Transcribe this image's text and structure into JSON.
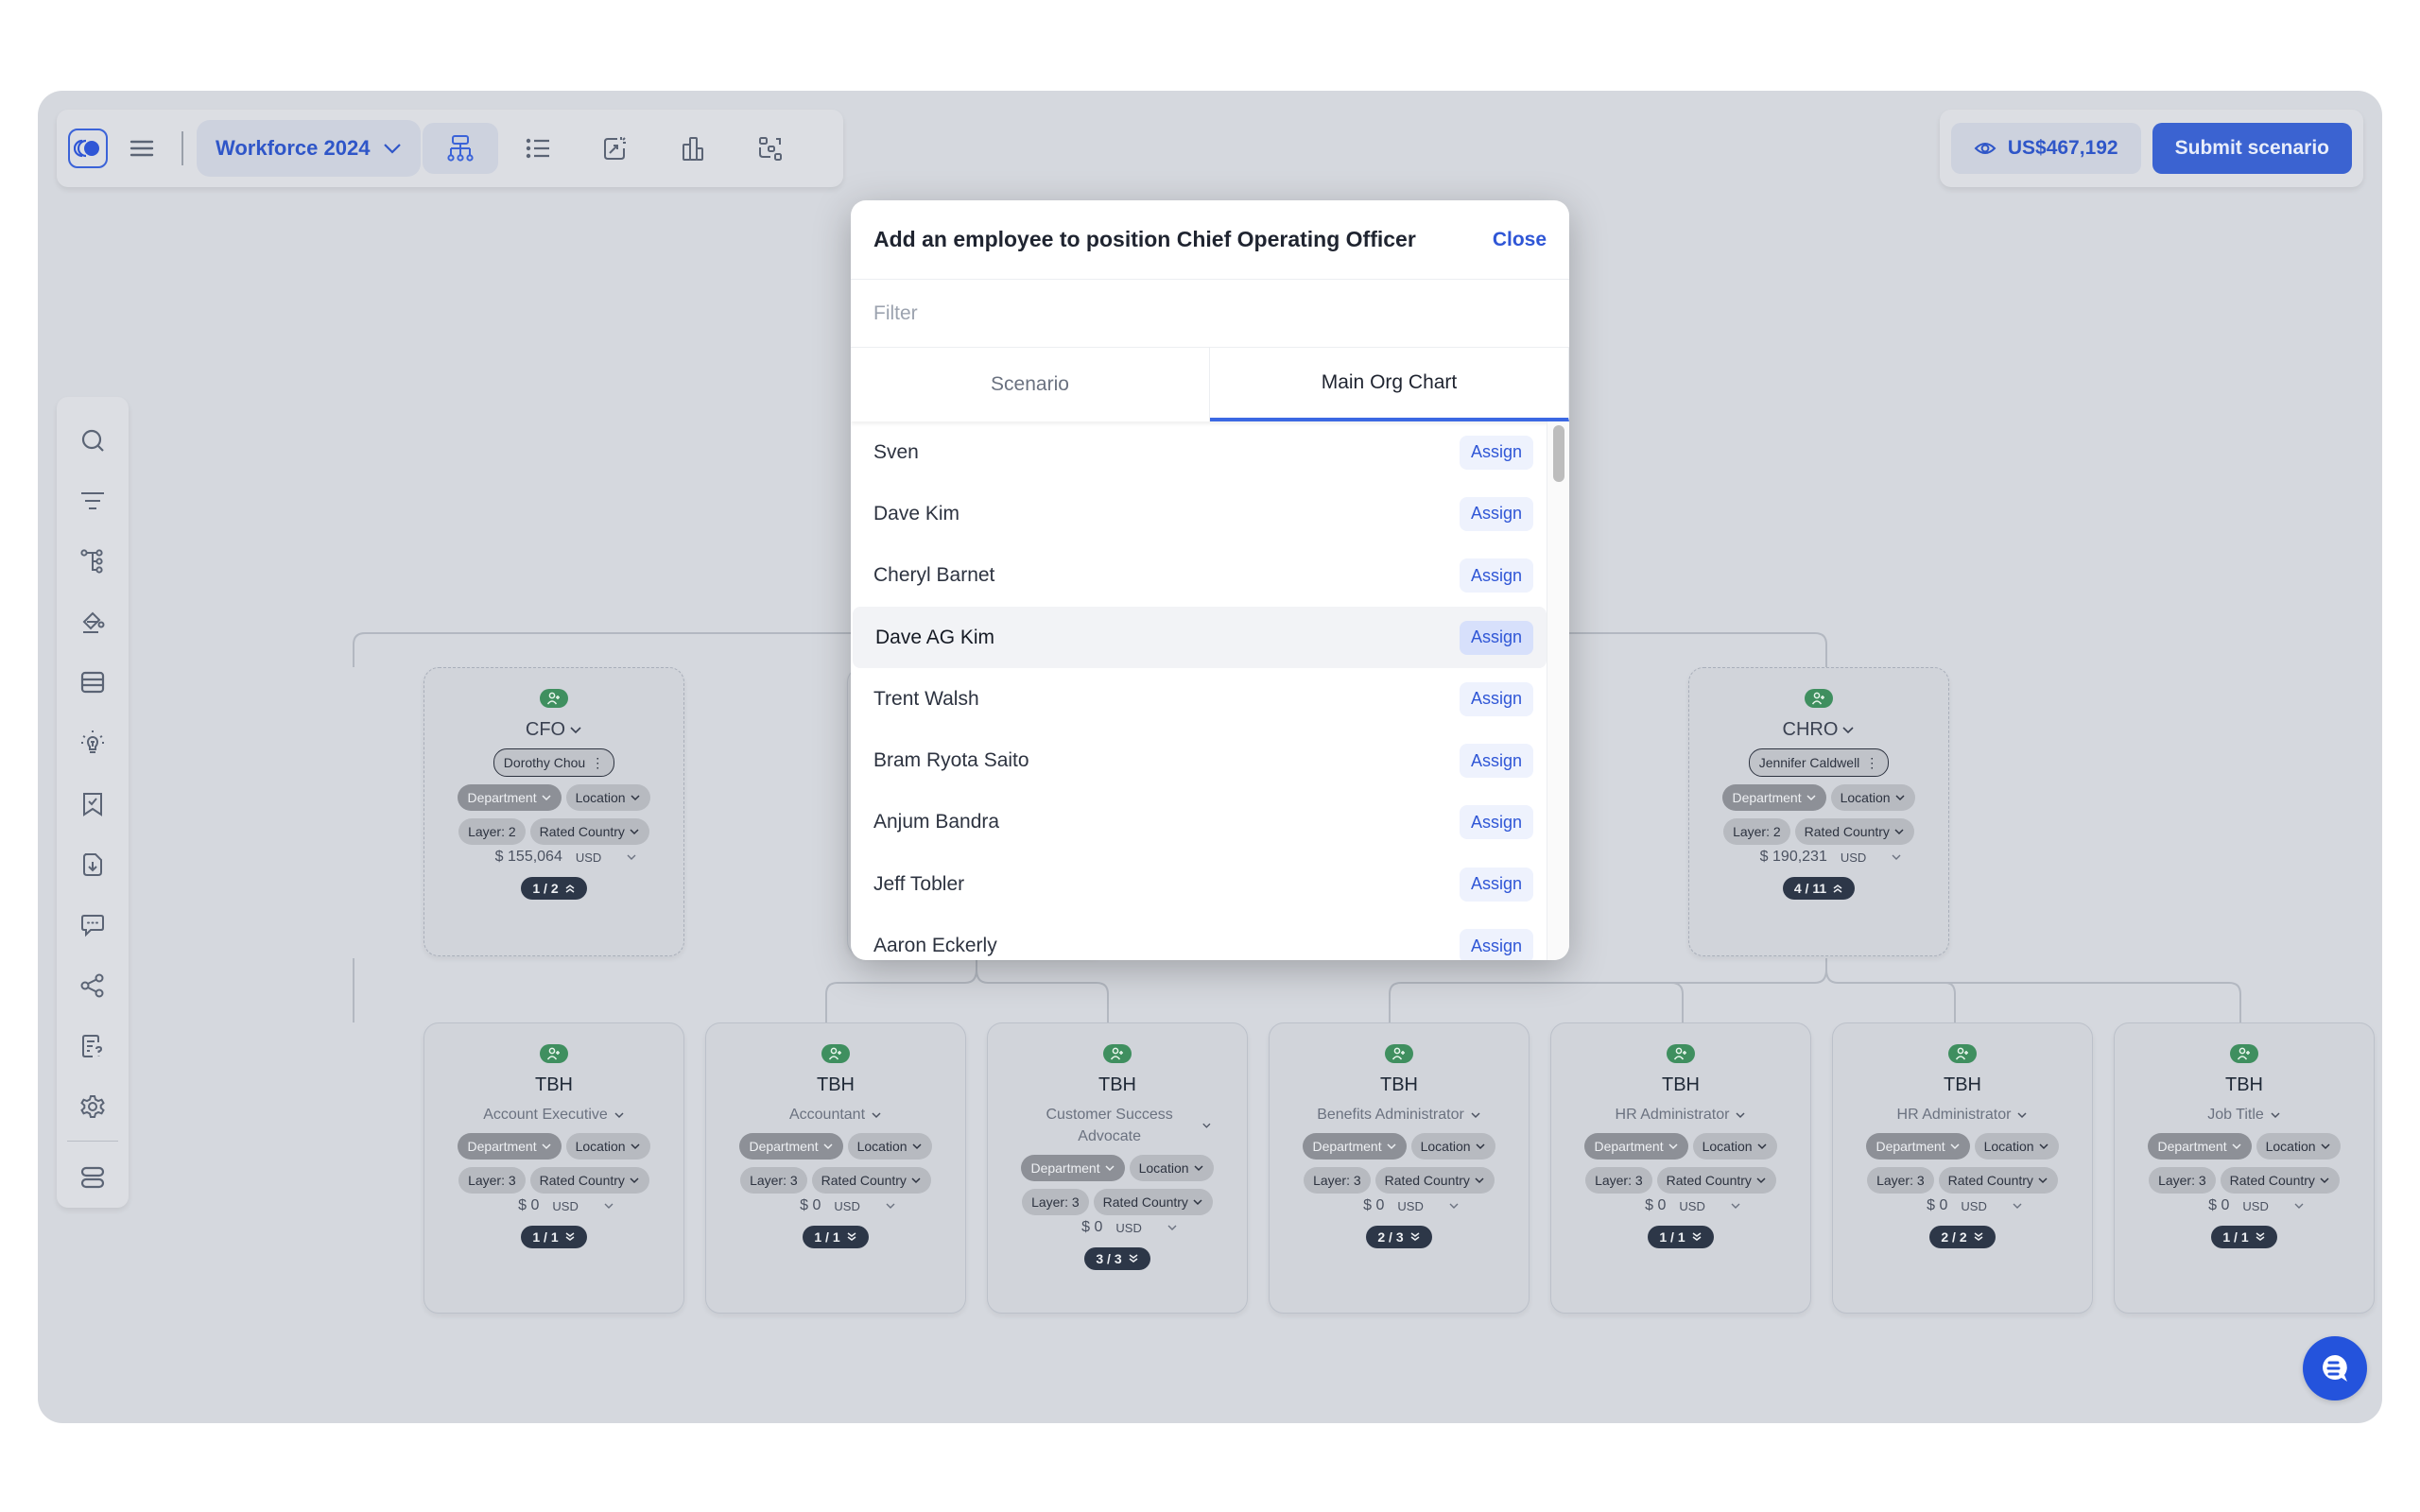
{
  "toolbar": {
    "scenario_name": "Workforce 2024",
    "view_buttons": [
      "org-chart-view",
      "list-view",
      "analytics-view",
      "bar-chart-view",
      "layout-view"
    ],
    "active_view": "org-chart-view"
  },
  "header_right": {
    "total_cost": "US$467,192",
    "submit_label": "Submit scenario"
  },
  "left_rail": {
    "items": [
      "search",
      "filter",
      "hierarchy",
      "paint-bucket",
      "table",
      "lightbulb",
      "bookmark-check",
      "file-download",
      "comment",
      "share",
      "document-question",
      "settings"
    ],
    "bottom_item": "layers"
  },
  "modal": {
    "title": "Add an employee to position Chief Operating Officer",
    "close_label": "Close",
    "filter_placeholder": "Filter",
    "filter_value": "",
    "tabs": [
      {
        "label": "Scenario",
        "active": false
      },
      {
        "label": "Main Org Chart",
        "active": true
      }
    ],
    "assign_label": "Assign",
    "employees": [
      {
        "name": "Sven"
      },
      {
        "name": "Dave Kim"
      },
      {
        "name": "Cheryl Barnet"
      },
      {
        "name": "Dave AG Kim",
        "hovered": true
      },
      {
        "name": "Trent Walsh"
      },
      {
        "name": "Bram Ryota Saito"
      },
      {
        "name": "Anjum Bandra"
      },
      {
        "name": "Jeff Tobler"
      },
      {
        "name": "Aaron Eckerly"
      }
    ]
  },
  "org_chart": {
    "chip_labels": {
      "department": "Department",
      "location": "Location",
      "rated_country": "Rated Country",
      "currency": "USD"
    },
    "layer2": [
      {
        "title": "CFO",
        "person": "Dorothy Chou",
        "layer": "Layer: 2",
        "salary": "$ 155,064",
        "count": "1 / 2",
        "expanded": true
      },
      {
        "title": "CHRO",
        "person": "Jennifer Caldwell",
        "layer": "Layer: 2",
        "salary": "$ 190,231",
        "count": "4 / 11",
        "expanded": true
      }
    ],
    "layer3": [
      {
        "name": "TBH",
        "job": "Account Executive",
        "layer": "Layer: 3",
        "salary": "$ 0",
        "count": "1 / 1"
      },
      {
        "name": "TBH",
        "job": "Accountant",
        "layer": "Layer: 3",
        "salary": "$ 0",
        "count": "1 / 1"
      },
      {
        "name": "TBH",
        "job": "Customer Success Advocate",
        "layer": "Layer: 3",
        "salary": "$ 0",
        "count": "3 / 3"
      },
      {
        "name": "TBH",
        "job": "Benefits Administrator",
        "layer": "Layer: 3",
        "salary": "$ 0",
        "count": "2 / 3"
      },
      {
        "name": "TBH",
        "job": "HR Administrator",
        "layer": "Layer: 3",
        "salary": "$ 0",
        "count": "1 / 1"
      },
      {
        "name": "TBH",
        "job": "HR Administrator",
        "layer": "Layer: 3",
        "salary": "$ 0",
        "count": "2 / 2"
      },
      {
        "name": "TBH",
        "job": "Job Title",
        "layer": "Layer: 3",
        "salary": "$ 0",
        "count": "1 / 1"
      }
    ]
  },
  "colors": {
    "accent": "#3b63d1",
    "canvas": "#d5d8de",
    "add_badge": "#3f8f5f",
    "count_pill": "#2d3748"
  }
}
